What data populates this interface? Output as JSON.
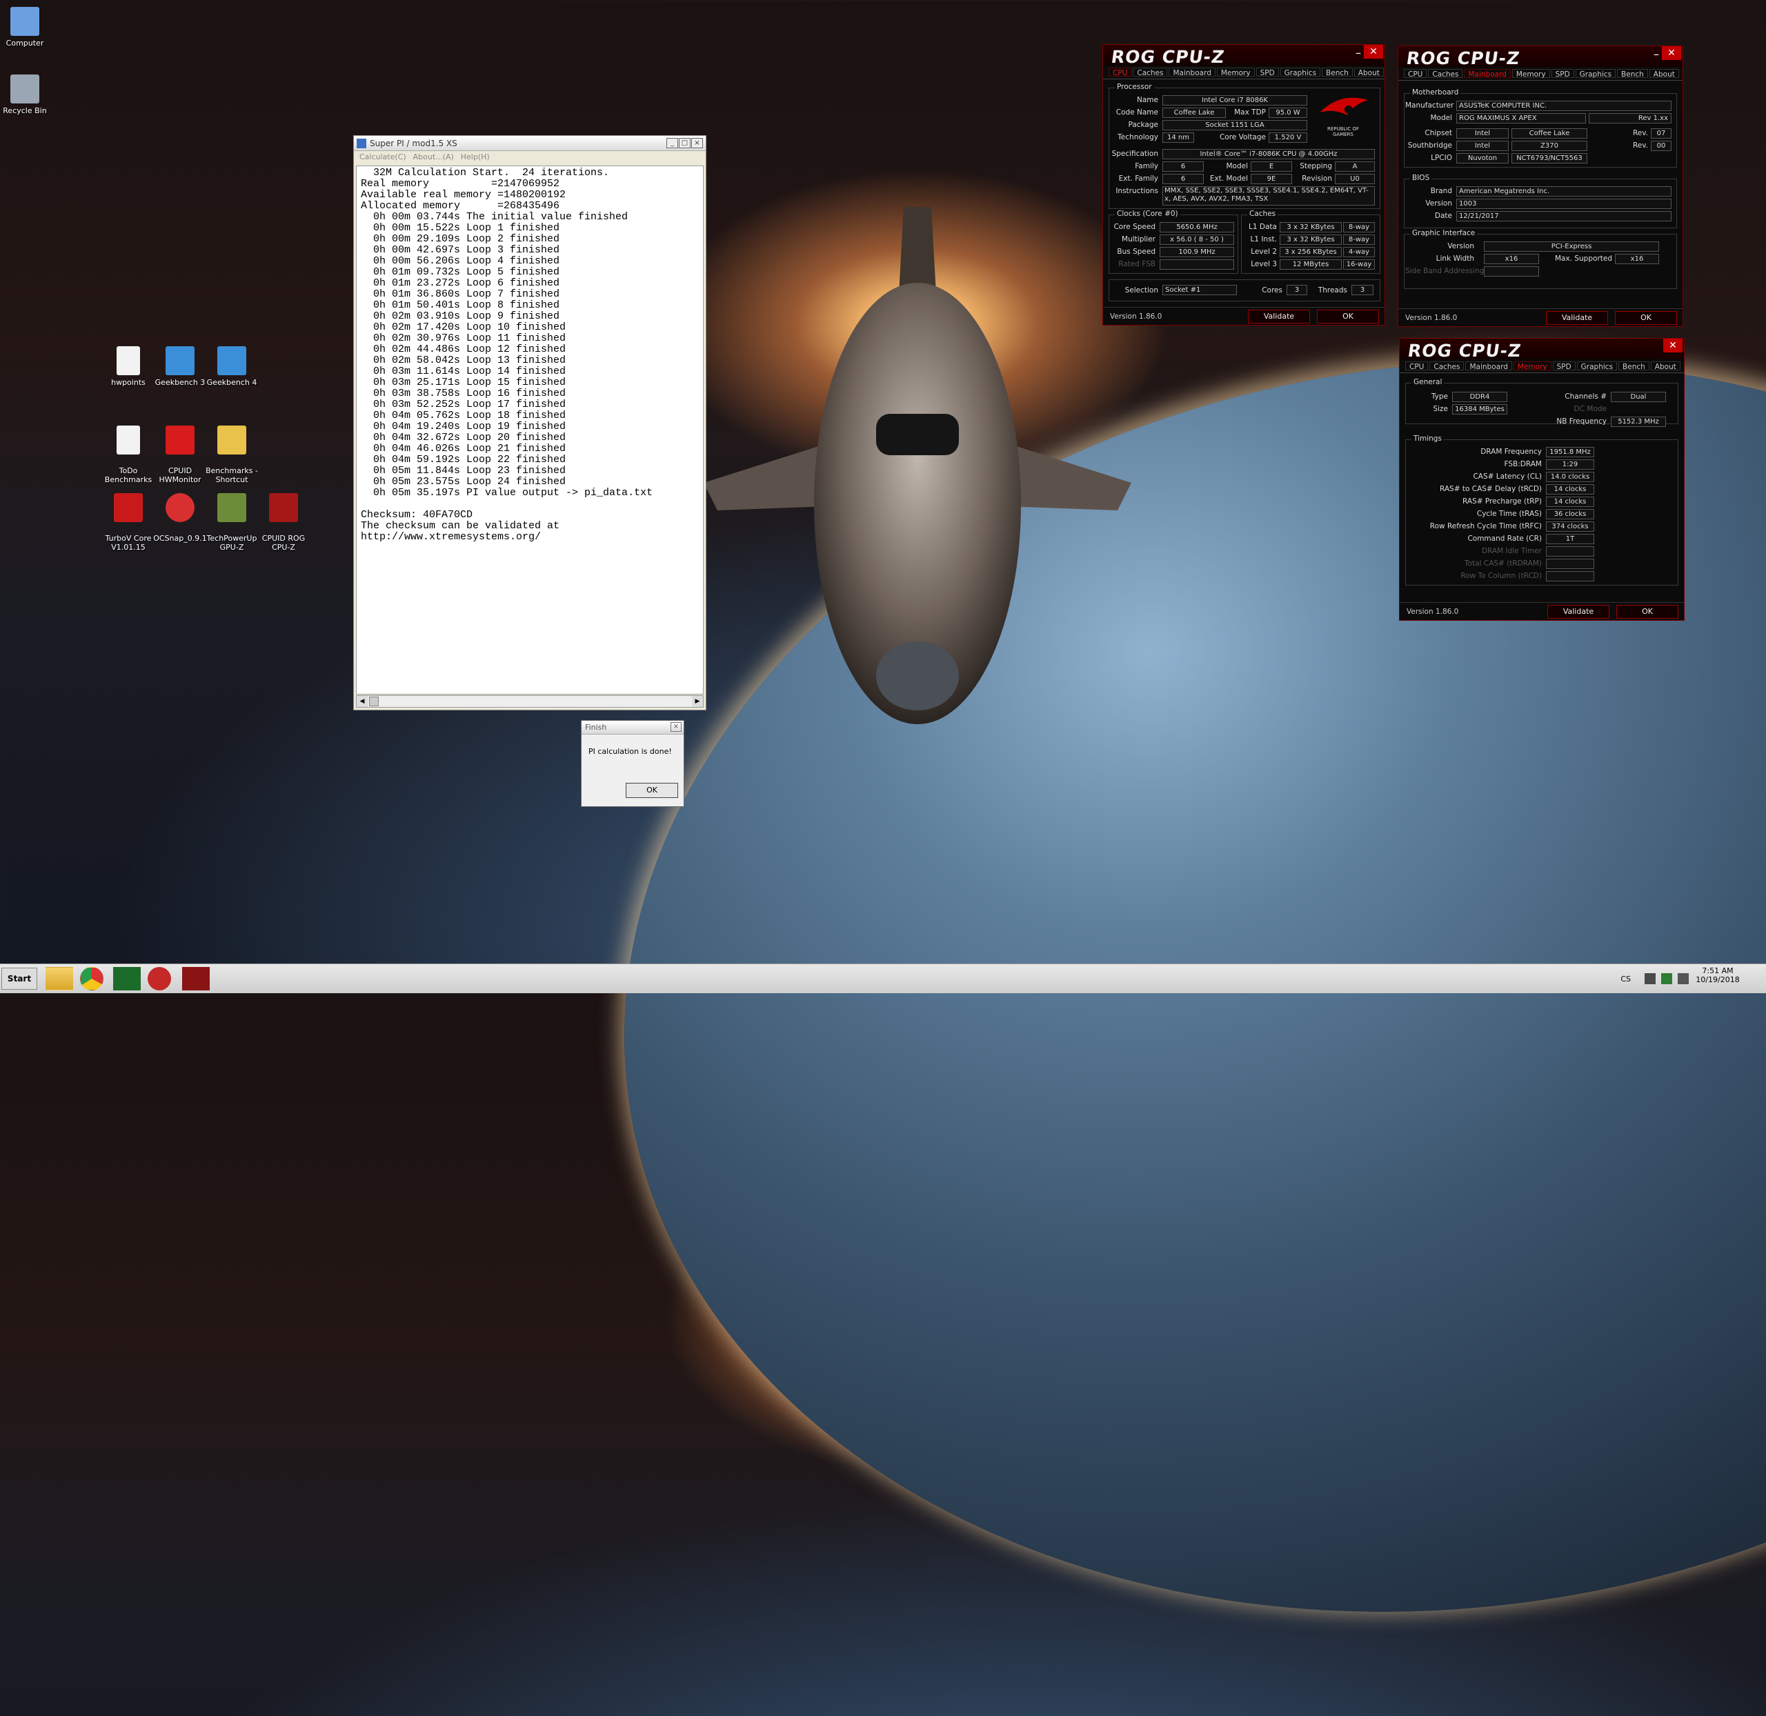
{
  "desktop": {
    "icons": [
      {
        "label": "Computer",
        "color": "#6aa0e0"
      },
      {
        "label": "Recycle Bin",
        "color": "#9aa6b4"
      },
      {
        "label": "hwpoints",
        "color": "#f2f2f2"
      },
      {
        "label": "Geekbench 3",
        "color": "#3b8fd8"
      },
      {
        "label": "Geekbench 4",
        "color": "#3b8fd8"
      },
      {
        "label": "ToDo\nBenchmarks",
        "color": "#f2f2f2"
      },
      {
        "label": "CPUID\nHWMonitor",
        "color": "#d81b1b"
      },
      {
        "label": "Benchmarks -\nShortcut",
        "color": "#e8c24b"
      },
      {
        "label": "TurboV Core\nV1.01.15",
        "color": "#c81a1a"
      },
      {
        "label": "OCSnap_0.9.1",
        "color": "#d83030"
      },
      {
        "label": "TechPowerUp\nGPU-Z",
        "color": "#6d8c3a"
      },
      {
        "label": "CPUID ROG\nCPU-Z",
        "color": "#a51818"
      }
    ]
  },
  "superpi": {
    "title": "Super PI / mod1.5 XS",
    "menu": [
      "Calculate(C)",
      "About...(A)",
      "Help(H)"
    ],
    "output": "  32M Calculation Start.  24 iterations.\nReal memory          =2147069952\nAvailable real memory =1480200192\nAllocated memory      =268435496\n  0h 00m 03.744s The initial value finished\n  0h 00m 15.522s Loop 1 finished\n  0h 00m 29.109s Loop 2 finished\n  0h 00m 42.697s Loop 3 finished\n  0h 00m 56.206s Loop 4 finished\n  0h 01m 09.732s Loop 5 finished\n  0h 01m 23.272s Loop 6 finished\n  0h 01m 36.860s Loop 7 finished\n  0h 01m 50.401s Loop 8 finished\n  0h 02m 03.910s Loop 9 finished\n  0h 02m 17.420s Loop 10 finished\n  0h 02m 30.976s Loop 11 finished\n  0h 02m 44.486s Loop 12 finished\n  0h 02m 58.042s Loop 13 finished\n  0h 03m 11.614s Loop 14 finished\n  0h 03m 25.171s Loop 15 finished\n  0h 03m 38.758s Loop 16 finished\n  0h 03m 52.252s Loop 17 finished\n  0h 04m 05.762s Loop 18 finished\n  0h 04m 19.240s Loop 19 finished\n  0h 04m 32.672s Loop 20 finished\n  0h 04m 46.026s Loop 21 finished\n  0h 04m 59.192s Loop 22 finished\n  0h 05m 11.844s Loop 23 finished\n  0h 05m 23.575s Loop 24 finished\n  0h 05m 35.197s PI value output -> pi_data.txt\n\nChecksum: 40FA70CD\nThe checksum can be validated at\nhttp://www.xtremesystems.org/"
  },
  "finish": {
    "title": "Finish",
    "message": "PI calculation is done!",
    "ok": "OK"
  },
  "rog_logo": "ROG CPU-Z",
  "tabs": [
    "CPU",
    "Caches",
    "Mainboard",
    "Memory",
    "SPD",
    "Graphics",
    "Bench",
    "About"
  ],
  "version": "Version 1.86.0",
  "validate": "Validate",
  "ok": "OK",
  "cpu": {
    "groups": {
      "processor": "Processor",
      "clocks": "Clocks (Core #0)",
      "caches": "Caches"
    },
    "labels": {
      "name": "Name",
      "codename": "Code Name",
      "maxtdp": "Max TDP",
      "package": "Package",
      "technology": "Technology",
      "corevoltage": "Core Voltage",
      "spec": "Specification",
      "family": "Family",
      "model": "Model",
      "stepping": "Stepping",
      "extfamily": "Ext. Family",
      "extmodel": "Ext. Model",
      "revision": "Revision",
      "instructions": "Instructions",
      "corespeed": "Core Speed",
      "multiplier": "Multiplier",
      "busspeed": "Bus Speed",
      "ratedfsb": "Rated FSB",
      "l1d": "L1 Data",
      "l1i": "L1 Inst.",
      "l2": "Level 2",
      "l3": "Level 3",
      "selection": "Selection",
      "cores": "Cores",
      "threads": "Threads"
    },
    "name": "Intel Core i7 8086K",
    "codename": "Coffee Lake",
    "maxtdp": "95.0 W",
    "package": "Socket 1151 LGA",
    "technology": "14 nm",
    "corevoltage": "1.520 V",
    "spec": "Intel® Core™ i7-8086K CPU @ 4.00GHz",
    "family": "6",
    "model": "E",
    "stepping": "A",
    "extfamily": "6",
    "extmodel": "9E",
    "revision": "U0",
    "instructions": "MMX, SSE, SSE2, SSE3, SSSE3, SSE4.1, SSE4.2, EM64T, VT-x, AES, AVX, AVX2, FMA3, TSX",
    "corespeed": "5650.6 MHz",
    "multiplier": "x 56.0 ( 8 - 50 )",
    "busspeed": "100.9 MHz",
    "l1d": "3 x 32 KBytes",
    "l1d_way": "8-way",
    "l1i": "3 x 32 KBytes",
    "l1i_way": "8-way",
    "l2": "3 x 256 KBytes",
    "l2_way": "4-way",
    "l3": "12 MBytes",
    "l3_way": "16-way",
    "selection": "Socket #1",
    "cores": "3",
    "threads": "3",
    "badge": "REPUBLIC OF\nGAMERS"
  },
  "mb": {
    "groups": {
      "motherboard": "Motherboard",
      "bios": "BIOS",
      "gi": "Graphic Interface"
    },
    "labels": {
      "manufacturer": "Manufacturer",
      "model": "Model",
      "chipset": "Chipset",
      "rev": "Rev.",
      "southbridge": "Southbridge",
      "lpcio": "LPCIO",
      "brand": "Brand",
      "version": "Version",
      "date": "Date",
      "gi_version": "Version",
      "linkwidth": "Link Width",
      "maxsupported": "Max. Supported",
      "sideband": "Side Band Addressing"
    },
    "manufacturer": "ASUSTeK COMPUTER INC.",
    "model": "ROG MAXIMUS X APEX",
    "model_rev": "Rev 1.xx",
    "chipset_vendor": "Intel",
    "chipset": "Coffee Lake",
    "chipset_rev": "07",
    "sb_vendor": "Intel",
    "sb": "Z370",
    "sb_rev": "00",
    "lpcio_vendor": "Nuvoton",
    "lpcio": "NCT6793/NCT5563",
    "brand": "American Megatrends Inc.",
    "version": "1003",
    "date": "12/21/2017",
    "gi_version": "PCI-Express",
    "linkwidth": "x16",
    "maxsupported": "x16"
  },
  "mem": {
    "groups": {
      "general": "General",
      "timings": "Timings"
    },
    "labels": {
      "type": "Type",
      "size": "Size",
      "channels": "Channels #",
      "dcmode": "DC Mode",
      "nbfreq": "NB Frequency",
      "dram": "DRAM Frequency",
      "fsb": "FSB:DRAM",
      "cl": "CAS# Latency (CL)",
      "trcd": "RAS# to CAS# Delay (tRCD)",
      "trp": "RAS# Precharge (tRP)",
      "tras": "Cycle Time (tRAS)",
      "trfc": "Row Refresh Cycle Time (tRFC)",
      "cr": "Command Rate (CR)",
      "idle": "DRAM Idle Timer",
      "trdram": "Total CAS# (tRDRAM)",
      "trcd2": "Row To Column (tRCD)"
    },
    "type": "DDR4",
    "size": "16384 MBytes",
    "channels": "Dual",
    "nbfreq": "5152.3 MHz",
    "dram": "1951.8 MHz",
    "fsb": "1:29",
    "cl": "14.0 clocks",
    "trcd": "14 clocks",
    "trp": "14 clocks",
    "tras": "36 clocks",
    "trfc": "374 clocks",
    "cr": "1T"
  },
  "taskbar": {
    "start": "Start",
    "lang": "CS",
    "time": "7:51 AM",
    "date": "10/19/2018"
  }
}
